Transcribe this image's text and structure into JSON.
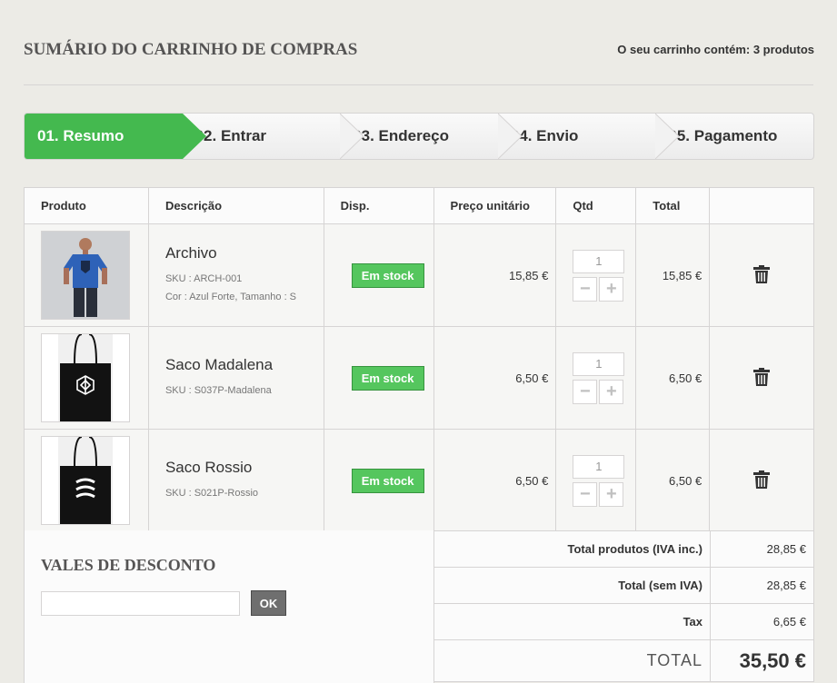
{
  "header": {
    "title": "SUMÁRIO DO CARRINHO DE COMPRAS",
    "cart_count": "O seu carrinho contém: 3 produtos"
  },
  "steps": [
    {
      "label": "01. Resumo",
      "active": true
    },
    {
      "label": "02. Entrar",
      "active": false
    },
    {
      "label": "03. Endereço",
      "active": false
    },
    {
      "label": "04. Envio",
      "active": false
    },
    {
      "label": "05. Pagamento",
      "active": false
    }
  ],
  "table": {
    "headers": [
      "Produto",
      "Descrição",
      "Disp.",
      "Preço unitário",
      "Qtd",
      "Total",
      ""
    ],
    "rows": [
      {
        "name": "Archivo",
        "sku": "SKU : ARCH-001",
        "attributes": "Cor : Azul Forte, Tamanho : S",
        "availability": "Em stock",
        "unit_price": "15,85 €",
        "qty": "1",
        "total": "15,85 €",
        "image": "tshirt-photo"
      },
      {
        "name": "Saco Madalena",
        "sku": "SKU : S037P-Madalena",
        "attributes": "",
        "availability": "Em stock",
        "unit_price": "6,50 €",
        "qty": "1",
        "total": "6,50 €",
        "image": "tote-bag-photo"
      },
      {
        "name": "Saco Rossio",
        "sku": "SKU : S021P-Rossio",
        "attributes": "",
        "availability": "Em stock",
        "unit_price": "6,50 €",
        "qty": "1",
        "total": "6,50 €",
        "image": "tote-bag-photo"
      }
    ],
    "qty_minus": "−",
    "qty_plus": "+"
  },
  "voucher": {
    "title": "VALES DE DESCONTO",
    "input_value": "",
    "ok_label": "OK"
  },
  "summary": {
    "total_products_label": "Total produtos (IVA inc.)",
    "total_products_value": "28,85 €",
    "total_no_vat_label": "Total (sem IVA)",
    "total_no_vat_value": "28,85 €",
    "tax_label": "Tax",
    "tax_value": "6,65 €",
    "total_label": "TOTAL",
    "total_value": "35,50 €"
  },
  "colors": {
    "active_step": "#44b94f",
    "stock_badge": "#55c65e",
    "background": "#ecebe6"
  }
}
